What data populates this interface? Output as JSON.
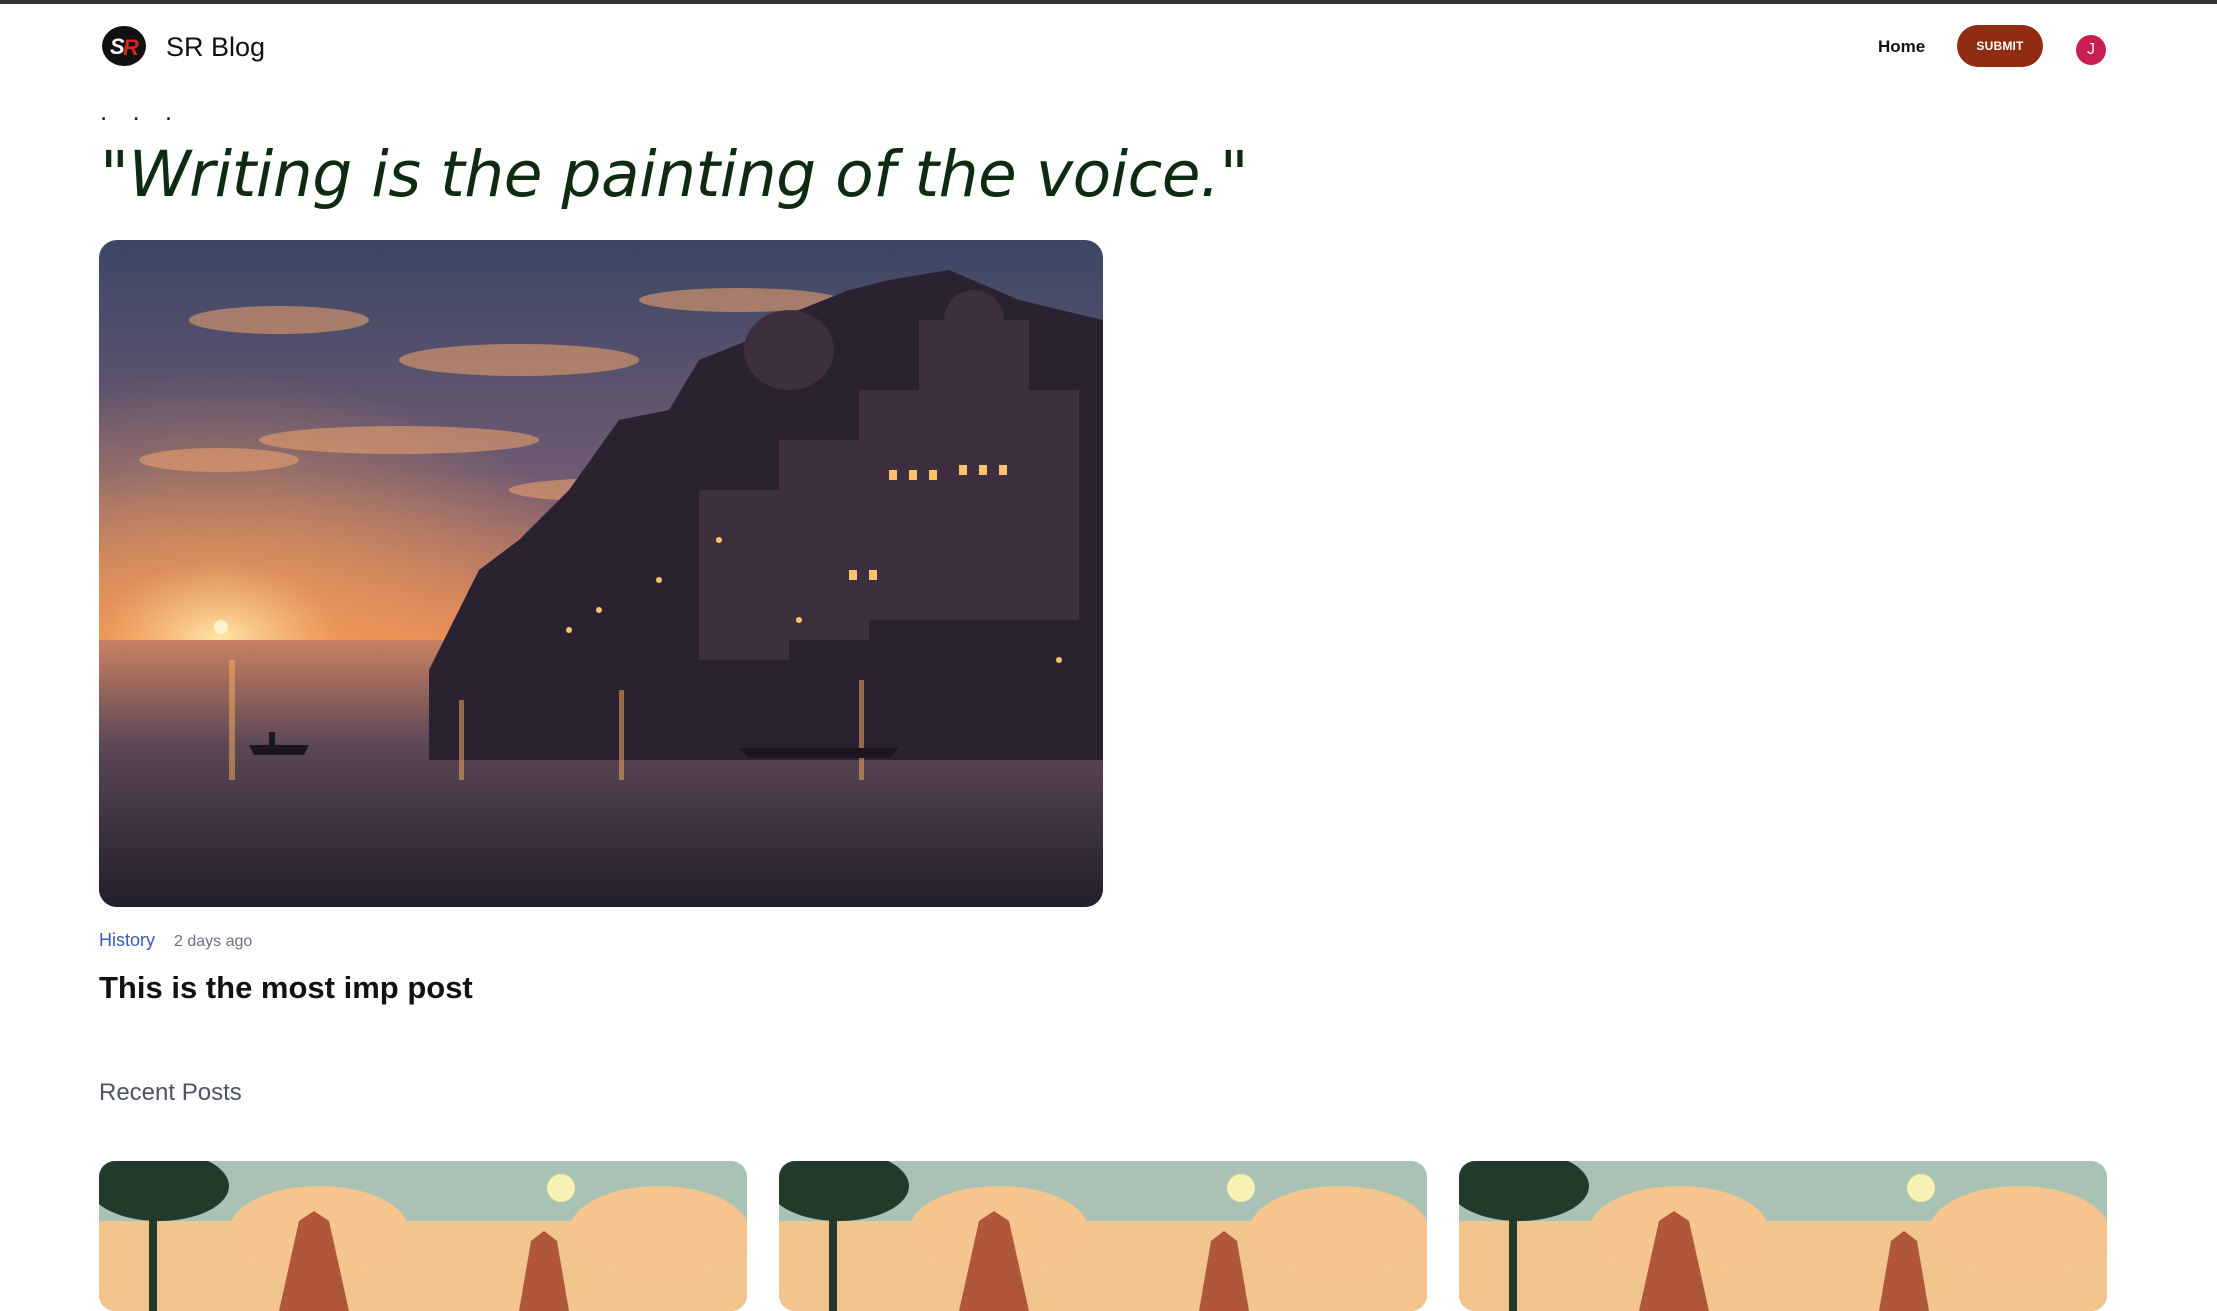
{
  "navbar": {
    "brand": "SR Blog",
    "logo_icon": "sr-logo-icon",
    "links": [
      {
        "label": "Home"
      }
    ],
    "submit_label": "SUBMIT",
    "avatar_initial": "J",
    "colors": {
      "submit_bg": "#8f2c12",
      "avatar_bg": "#c81e50"
    }
  },
  "hero": {
    "ellipsis": ". . .",
    "quote": "\"Writing is the painting of the voice.\"",
    "quote_color": "#0e2b12"
  },
  "featured_post": {
    "image_icon": "riverside-city-sunset-image",
    "category": "History",
    "time": "2 days ago",
    "title": "This is the most imp post"
  },
  "recent": {
    "heading": "Recent Posts",
    "posts": [
      {
        "image_icon": "temple-sunset-image"
      },
      {
        "image_icon": "temple-sunset-image"
      },
      {
        "image_icon": "temple-sunset-image"
      }
    ]
  }
}
